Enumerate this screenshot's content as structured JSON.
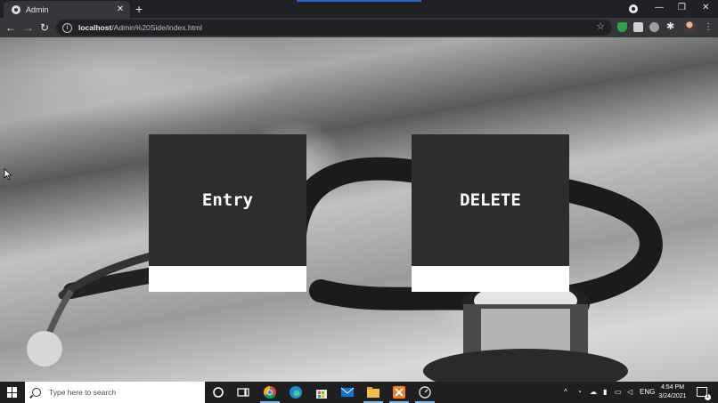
{
  "browser": {
    "tab_title": "Admin",
    "tab_close": "✕",
    "new_tab": "+",
    "window_controls": {
      "minimize": "—",
      "restore": "❐",
      "close": "✕"
    },
    "back": "←",
    "forward": "→",
    "reload": "↻",
    "url_host": "localhost",
    "url_path": "/Admin%20Side/index.html",
    "star": "☆",
    "menu": "⋮"
  },
  "page": {
    "cards": [
      {
        "label": "Entry"
      },
      {
        "label": "DELETE"
      }
    ]
  },
  "taskbar": {
    "search_placeholder": "Type here to search",
    "tray": {
      "lang": "ENG",
      "chevron": "^"
    },
    "clock_time": "4:54 PM",
    "clock_date": "3/24/2021",
    "notification_count": "1"
  },
  "icons": [
    "favicon-icon",
    "close-icon",
    "plus-icon",
    "back-icon",
    "forward-icon",
    "reload-icon",
    "info-icon",
    "star-icon",
    "extension-icon",
    "avatar",
    "kebab-icon",
    "windows-icon",
    "search-icon",
    "cortana-icon",
    "taskview-icon",
    "chrome-icon",
    "edge-icon",
    "store-icon",
    "mail-icon",
    "file-explorer-icon",
    "xampp-icon",
    "app-icon",
    "notification-icon"
  ],
  "colors": {
    "card_bg": "#2d2d2d",
    "card_footer": "#ffffff",
    "card_text": "#ffffff",
    "chrome_dark": "#202124",
    "chrome_toolbar": "#35363a"
  }
}
